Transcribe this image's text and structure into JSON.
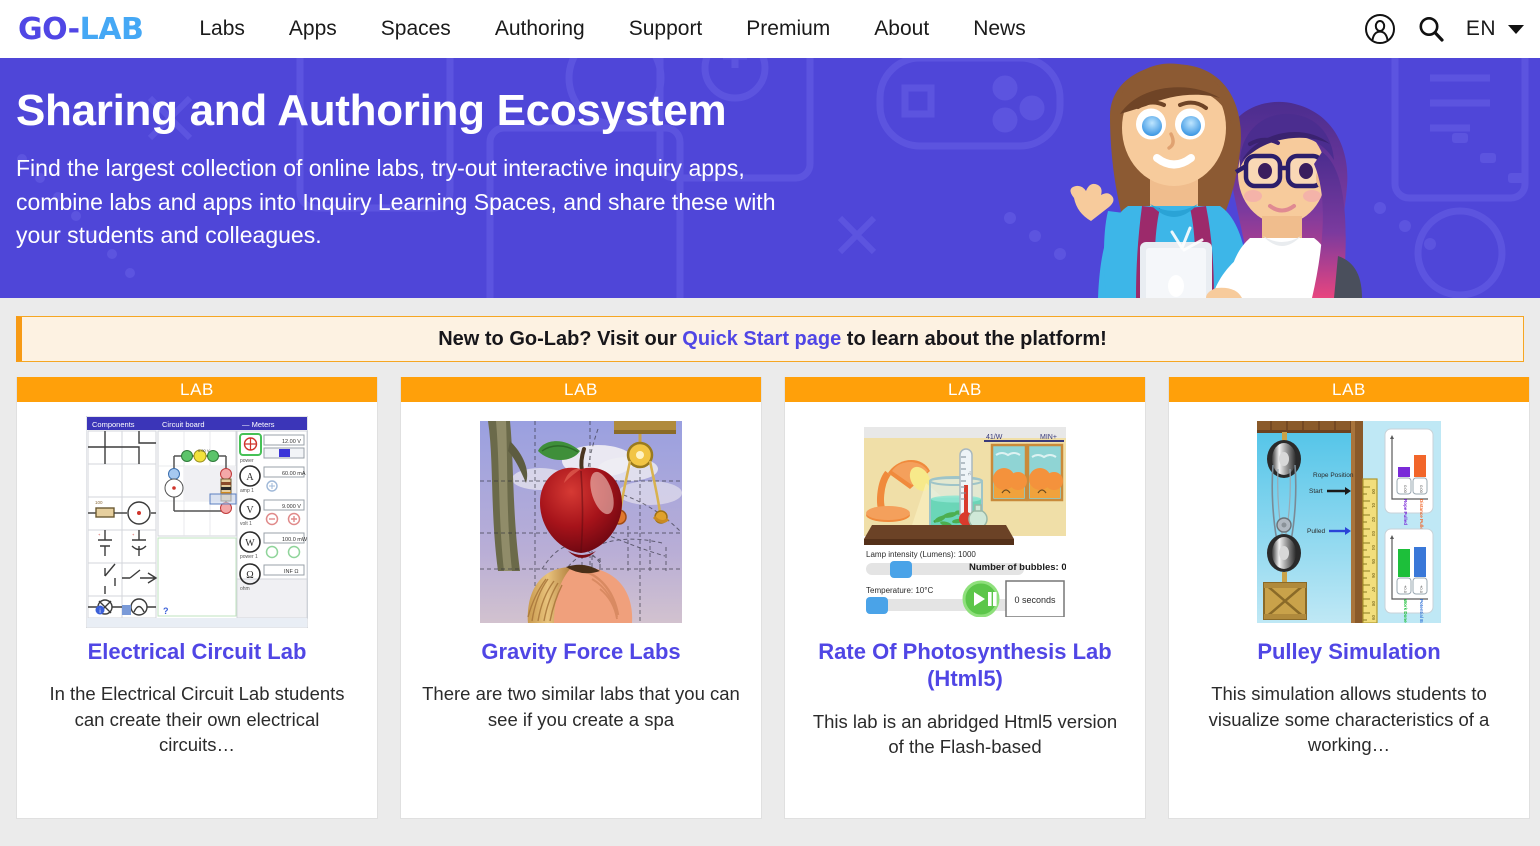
{
  "header": {
    "logo": {
      "part1": "GO-",
      "part2": "LAB"
    },
    "nav": [
      {
        "label": "Labs"
      },
      {
        "label": "Apps"
      },
      {
        "label": "Spaces"
      },
      {
        "label": "Authoring"
      },
      {
        "label": "Support"
      },
      {
        "label": "Premium"
      },
      {
        "label": "About"
      },
      {
        "label": "News"
      }
    ],
    "account_icon": "user-account-icon",
    "search_icon": "search-icon",
    "language": "EN",
    "language_caret": "chevron-down-icon"
  },
  "hero": {
    "title": "Sharing and Authoring Ecosystem",
    "subtitle": "Find the largest collection of online labs, try-out interactive inquiry apps, combine labs and apps into Inquiry Learning Spaces, and share these with your students and colleagues.",
    "background_color": "#4f46d8",
    "illustration": "two-students-with-tablet-illustration"
  },
  "notice": {
    "text_before": "New to Go-Lab? Visit our ",
    "link": "Quick Start page",
    "text_after": " to learn about the platform!",
    "border_color": "#f5a623",
    "background_color": "#fdf2e2"
  },
  "cards": [
    {
      "badge": "LAB",
      "title": "Electrical Circuit Lab",
      "description": "In the Electrical Circuit Lab students can create their own electrical circuits…",
      "thumbnail": "electrical-circuit-lab-thumbnail"
    },
    {
      "badge": "LAB",
      "title": "Gravity Force Labs",
      "description": "There are two similar labs that you can see if you create a spa",
      "thumbnail": "gravity-force-apple-thumbnail"
    },
    {
      "badge": "LAB",
      "title": "Rate Of Photosynthesis Lab (Html5)",
      "description": "This lab is an abridged Html5 version of the Flash-based",
      "thumbnail": "photosynthesis-lab-thumbnail"
    },
    {
      "badge": "LAB",
      "title": "Pulley Simulation",
      "description": "This simulation allows students to visualize some characteristics of a working…",
      "thumbnail": "pulley-simulation-thumbnail"
    }
  ],
  "colors": {
    "brand_purple": "#5046e5",
    "brand_blue": "#45a8f5",
    "badge_orange": "#ffa00a",
    "page_background": "#ebebeb"
  }
}
